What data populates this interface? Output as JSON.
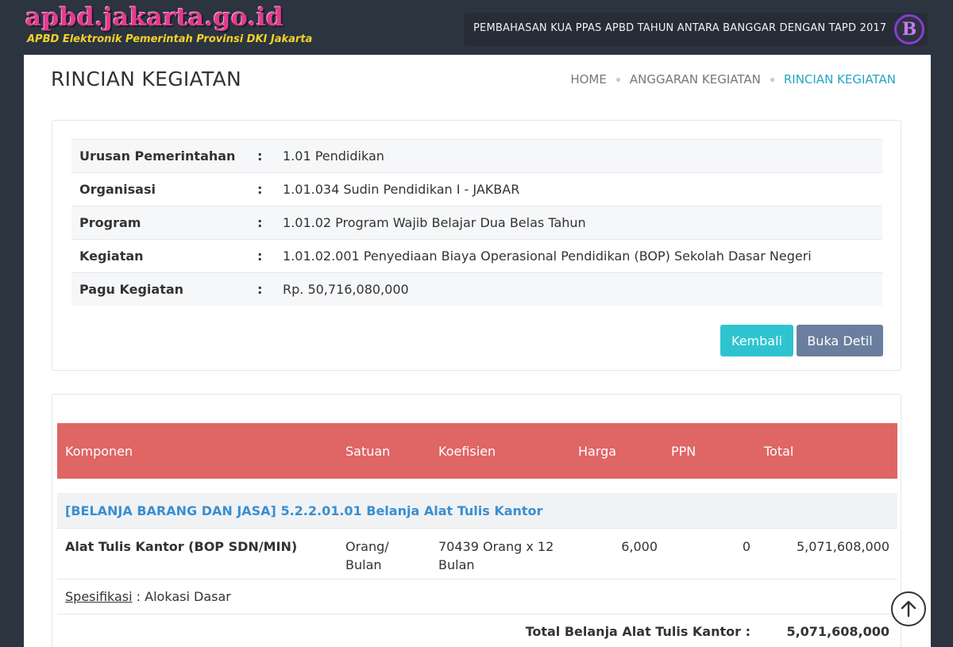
{
  "header": {
    "site_name": "apbd.jakarta.go.id",
    "site_subtitle": "APBD Elektronik Pemerintah Provinsi DKI Jakarta",
    "session_title": "PEMBAHASAN KUA PPAS APBD TAHUN ANTARA BANGGAR DENGAN TAPD 2017",
    "badge_letter": "B"
  },
  "page": {
    "title": "RINCIAN KEGIATAN",
    "breadcrumb": [
      "HOME",
      "ANGGARAN KEGIATAN",
      "RINCIAN KEGIATAN"
    ]
  },
  "info": [
    {
      "label": "Urusan Pemerintahan",
      "value": "1.01 Pendidikan"
    },
    {
      "label": "Organisasi",
      "value": "1.01.034 Sudin Pendidikan I - JAKBAR"
    },
    {
      "label": "Program",
      "value": "1.01.02 Program Wajib Belajar Dua Belas Tahun"
    },
    {
      "label": "Kegiatan",
      "value": "1.01.02.001 Penyediaan Biaya Operasional Pendidikan (BOP) Sekolah Dasar Negeri"
    },
    {
      "label": "Pagu Kegiatan",
      "value": "Rp. 50,716,080,000"
    }
  ],
  "info_colon": ":",
  "buttons": {
    "kembali": "Kembali",
    "buka_detil": "Buka Detil"
  },
  "table": {
    "columns": [
      "Komponen",
      "Satuan",
      "Koefisien",
      "Harga",
      "PPN",
      "Total"
    ],
    "group_title": "[BELANJA BARANG DAN JASA] 5.2.2.01.01 Belanja Alat Tulis Kantor",
    "item": {
      "komponen": "Alat Tulis Kantor (BOP SDN/MIN)",
      "satuan_1": "Orang/",
      "satuan_2": "Bulan",
      "koefisien_1": "70439 Orang x 12",
      "koefisien_2": "Bulan",
      "harga": "6,000",
      "ppn": "0",
      "total": "5,071,608,000"
    },
    "spec_label": "Spesifikasi",
    "spec_value": " : Alokasi Dasar",
    "total_label": "Total Belanja Alat Tulis Kantor :",
    "total_value": "5,071,608,000"
  },
  "icons": {
    "scroll_top": "arrow-up-circle-icon"
  },
  "colors": {
    "header_bg": "#2c3440",
    "table_header": "#e06565",
    "group_text": "#3a8fd0",
    "btn_kembali": "#2ec4cf",
    "btn_detil": "#6a7f9e",
    "breadcrumb_active": "#26a5c6"
  }
}
